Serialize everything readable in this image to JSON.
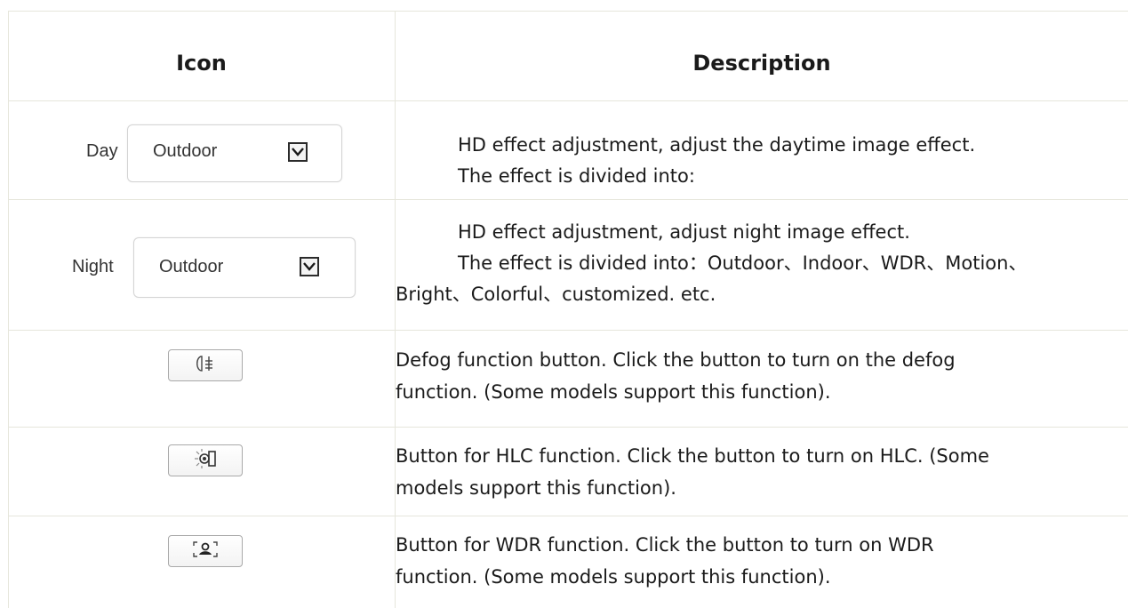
{
  "table": {
    "headers": {
      "icon": "Icon",
      "description": "Description"
    },
    "rows": [
      {
        "icon": {
          "type": "select",
          "label": "Day",
          "value": "Outdoor",
          "icon_name": "dropdown-arrow-icon"
        },
        "description": [
          "HD effect adjustment, adjust the daytime image effect.",
          "The effect is divided into:"
        ]
      },
      {
        "icon": {
          "type": "select",
          "label": "Night",
          "value": "Outdoor",
          "icon_name": "dropdown-arrow-icon"
        },
        "description": [
          "HD effect adjustment, adjust night image effect.",
          "The effect is divided into：Outdoor、Indoor、WDR、Motion、",
          "Bright、Colorful、customized. etc."
        ]
      },
      {
        "icon": {
          "type": "button",
          "icon_name": "defog-icon"
        },
        "description": [
          "Defog function button. Click the button to turn on the defog",
          "function. (Some models support this function)."
        ]
      },
      {
        "icon": {
          "type": "button",
          "icon_name": "hlc-icon"
        },
        "description": [
          "Button for HLC function. Click the button to turn on HLC. (Some",
          "models support this function)."
        ]
      },
      {
        "icon": {
          "type": "button",
          "icon_name": "wdr-icon"
        },
        "description": [
          "Button for WDR function. Click the button to turn on WDR",
          "function. (Some models support this function)."
        ]
      }
    ]
  },
  "colors": {
    "grid": "#e6e6dc",
    "text": "#1a1a1a"
  }
}
